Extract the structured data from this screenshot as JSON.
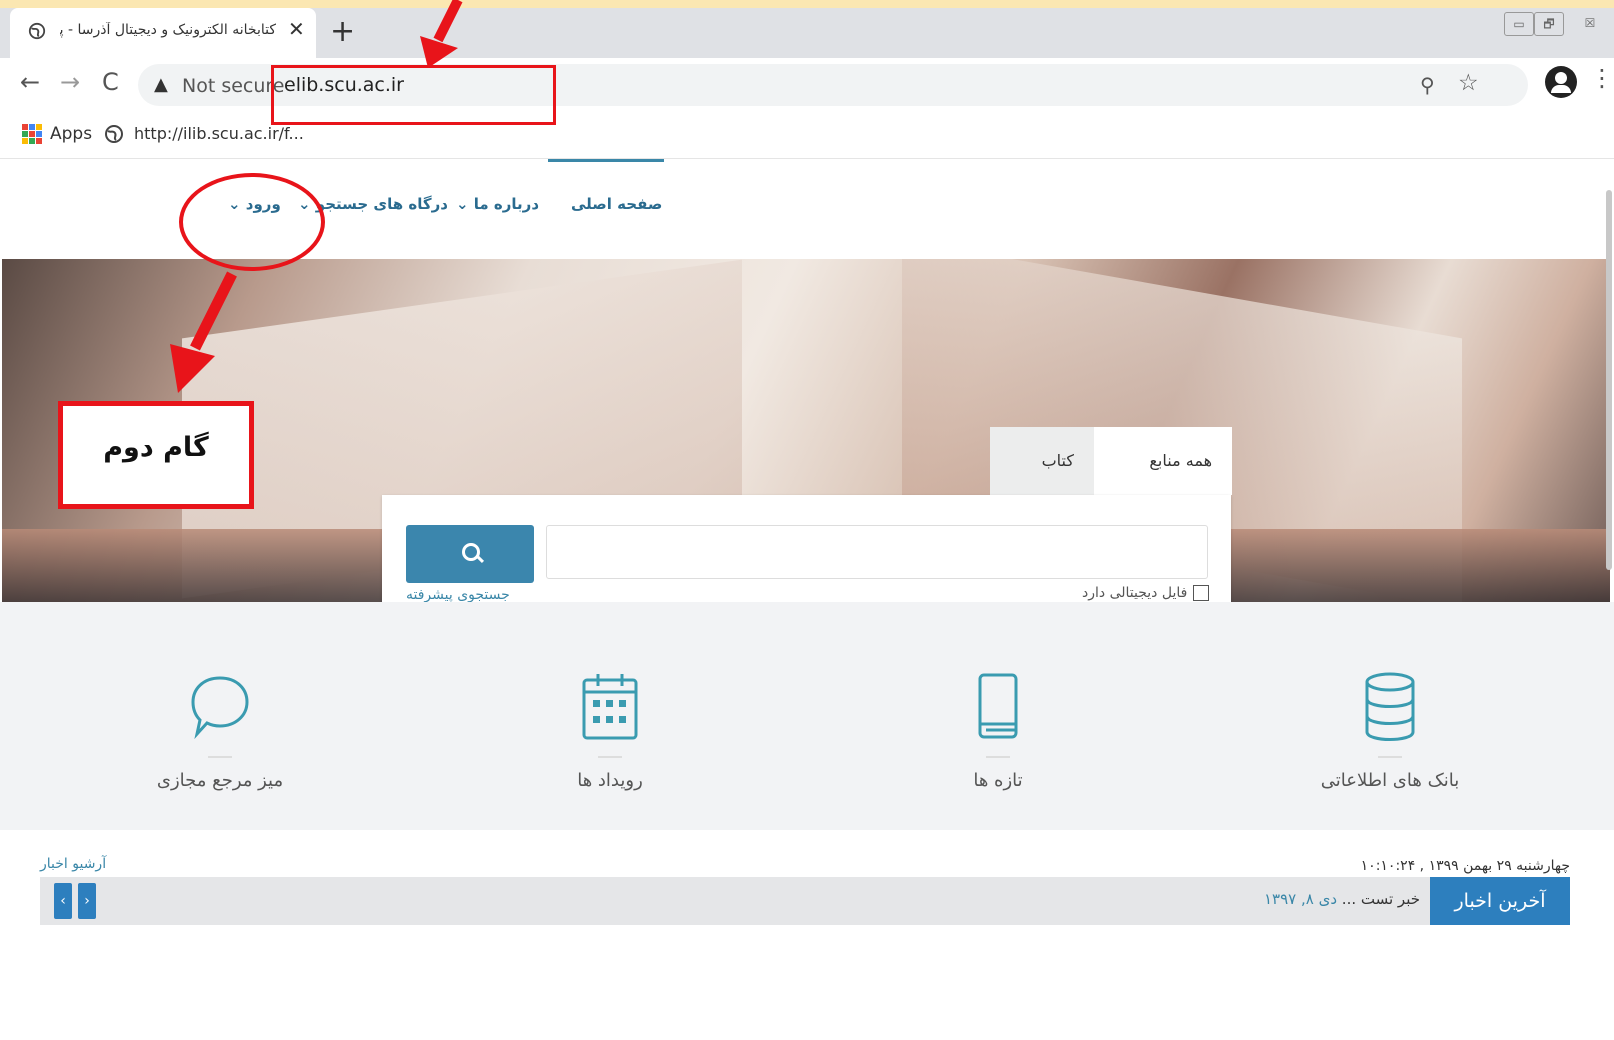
{
  "browser": {
    "tab_title": "کتابخانه الکترونیک و دیجیتال آذرسا - پک سا",
    "tab_close": "✕",
    "new_tab": "+",
    "win_minimize": "▭",
    "win_restore": "🗗",
    "win_close": "☒",
    "back": "←",
    "forward": "→",
    "reload": "C",
    "warning": "▲",
    "not_secure": "Not secure",
    "url": "elib.scu.ac.ir",
    "zoom": "⚲",
    "star": "☆",
    "menu": "⋮",
    "apps_label": "Apps",
    "bookmark_label": "http://ilib.scu.ac.ir/f..."
  },
  "nav": {
    "home": "صفحه اصلی",
    "about": "درباره ما ⌄",
    "portals": "درگاه های جستجو ⌄",
    "login": "ورود ⌄"
  },
  "search": {
    "tab_all": "همه منابع",
    "tab_book": "کتاب",
    "advanced": "جستجوی پیشرفته",
    "digital_file": "فایل دیجیتالی دارد"
  },
  "features": [
    {
      "label": "بانک های اطلاعاتی",
      "icon": "database-icon"
    },
    {
      "label": "تازه ها",
      "icon": "book-icon"
    },
    {
      "label": "رویداد ها",
      "icon": "calendar-icon"
    },
    {
      "label": "میز مرجع مجازی",
      "icon": "chat-bubble-icon"
    }
  ],
  "news": {
    "date": "چهارشنبه ۲۹ بهمن ۱۳۹۹ , ۱۰:۱۰:۲۴",
    "archive": "آرشیو اخبار",
    "latest": "آخرین اخبار",
    "item_text": "خبر تست ...",
    "item_date": "دی ۸, ۱۳۹۷",
    "prev": "‹",
    "next": "›"
  },
  "annotation": {
    "step_label": "گام دوم"
  },
  "colors": {
    "annotation_red": "#e8141a",
    "accent_blue": "#3b86ad",
    "news_blue": "#2d7fbe",
    "frame_bg": "#fbe7b2"
  }
}
